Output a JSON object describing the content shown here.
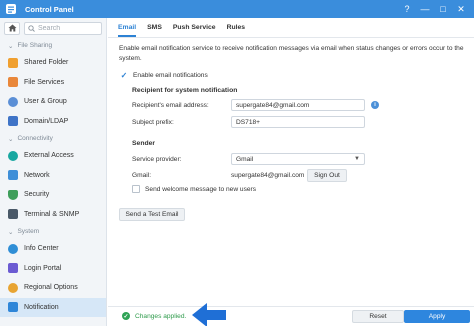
{
  "window": {
    "title": "Control Panel",
    "help_glyph": "?",
    "minimize_glyph": "—",
    "maximize_glyph": "□",
    "close_glyph": "✕"
  },
  "sidebar": {
    "search_placeholder": "Search",
    "groups": [
      {
        "label": "File Sharing",
        "items": [
          {
            "label": "Shared Folder",
            "icon": "shared-folder-icon",
            "color": "#f0a030"
          },
          {
            "label": "File Services",
            "icon": "file-services-icon",
            "color": "#e9873a"
          },
          {
            "label": "User & Group",
            "icon": "user-group-icon",
            "color": "#5b8fd6"
          },
          {
            "label": "Domain/LDAP",
            "icon": "domain-ldap-icon",
            "color": "#3f74c7"
          }
        ]
      },
      {
        "label": "Connectivity",
        "items": [
          {
            "label": "External Access",
            "icon": "external-access-icon",
            "color": "#18a7a0"
          },
          {
            "label": "Network",
            "icon": "network-icon",
            "color": "#3f8fd8"
          },
          {
            "label": "Security",
            "icon": "security-icon",
            "color": "#3e9e5a"
          },
          {
            "label": "Terminal & SNMP",
            "icon": "terminal-icon",
            "color": "#4a5968"
          }
        ]
      },
      {
        "label": "System",
        "items": [
          {
            "label": "Info Center",
            "icon": "info-center-icon",
            "color": "#2f8ed6"
          },
          {
            "label": "Login Portal",
            "icon": "login-portal-icon",
            "color": "#6b5bd2"
          },
          {
            "label": "Regional Options",
            "icon": "regional-options-icon",
            "color": "#e8a432"
          },
          {
            "label": "Notification",
            "icon": "notification-icon",
            "color": "#2f86d8"
          }
        ]
      }
    ]
  },
  "tabs": [
    {
      "label": "Email"
    },
    {
      "label": "SMS"
    },
    {
      "label": "Push Service"
    },
    {
      "label": "Rules"
    }
  ],
  "content": {
    "description": "Enable email notification service to receive notification messages via email when status changes or errors occur to the system.",
    "enable_label": "Enable email notifications",
    "recipient_title": "Recipient for system notification",
    "recipient_email_label": "Recipient's email address:",
    "recipient_email_value": "supergate84@gmail.com",
    "subject_prefix_label": "Subject prefix:",
    "subject_prefix_value": "DS718+",
    "sender_title": "Sender",
    "service_provider_label": "Service provider:",
    "service_provider_value": "Gmail",
    "gmail_label": "Gmail:",
    "gmail_value": "supergate84@gmail.com",
    "sign_out_label": "Sign Out",
    "welcome_label": "Send welcome message to new users",
    "test_email_label": "Send a Test Email"
  },
  "footer": {
    "status_text": "Changes applied.",
    "reset_label": "Reset",
    "apply_label": "Apply"
  },
  "colors": {
    "accent": "#2e86de",
    "titlebar": "#3a8ddc",
    "success": "#2fa356",
    "annotation_arrow": "#1f6fd6"
  }
}
